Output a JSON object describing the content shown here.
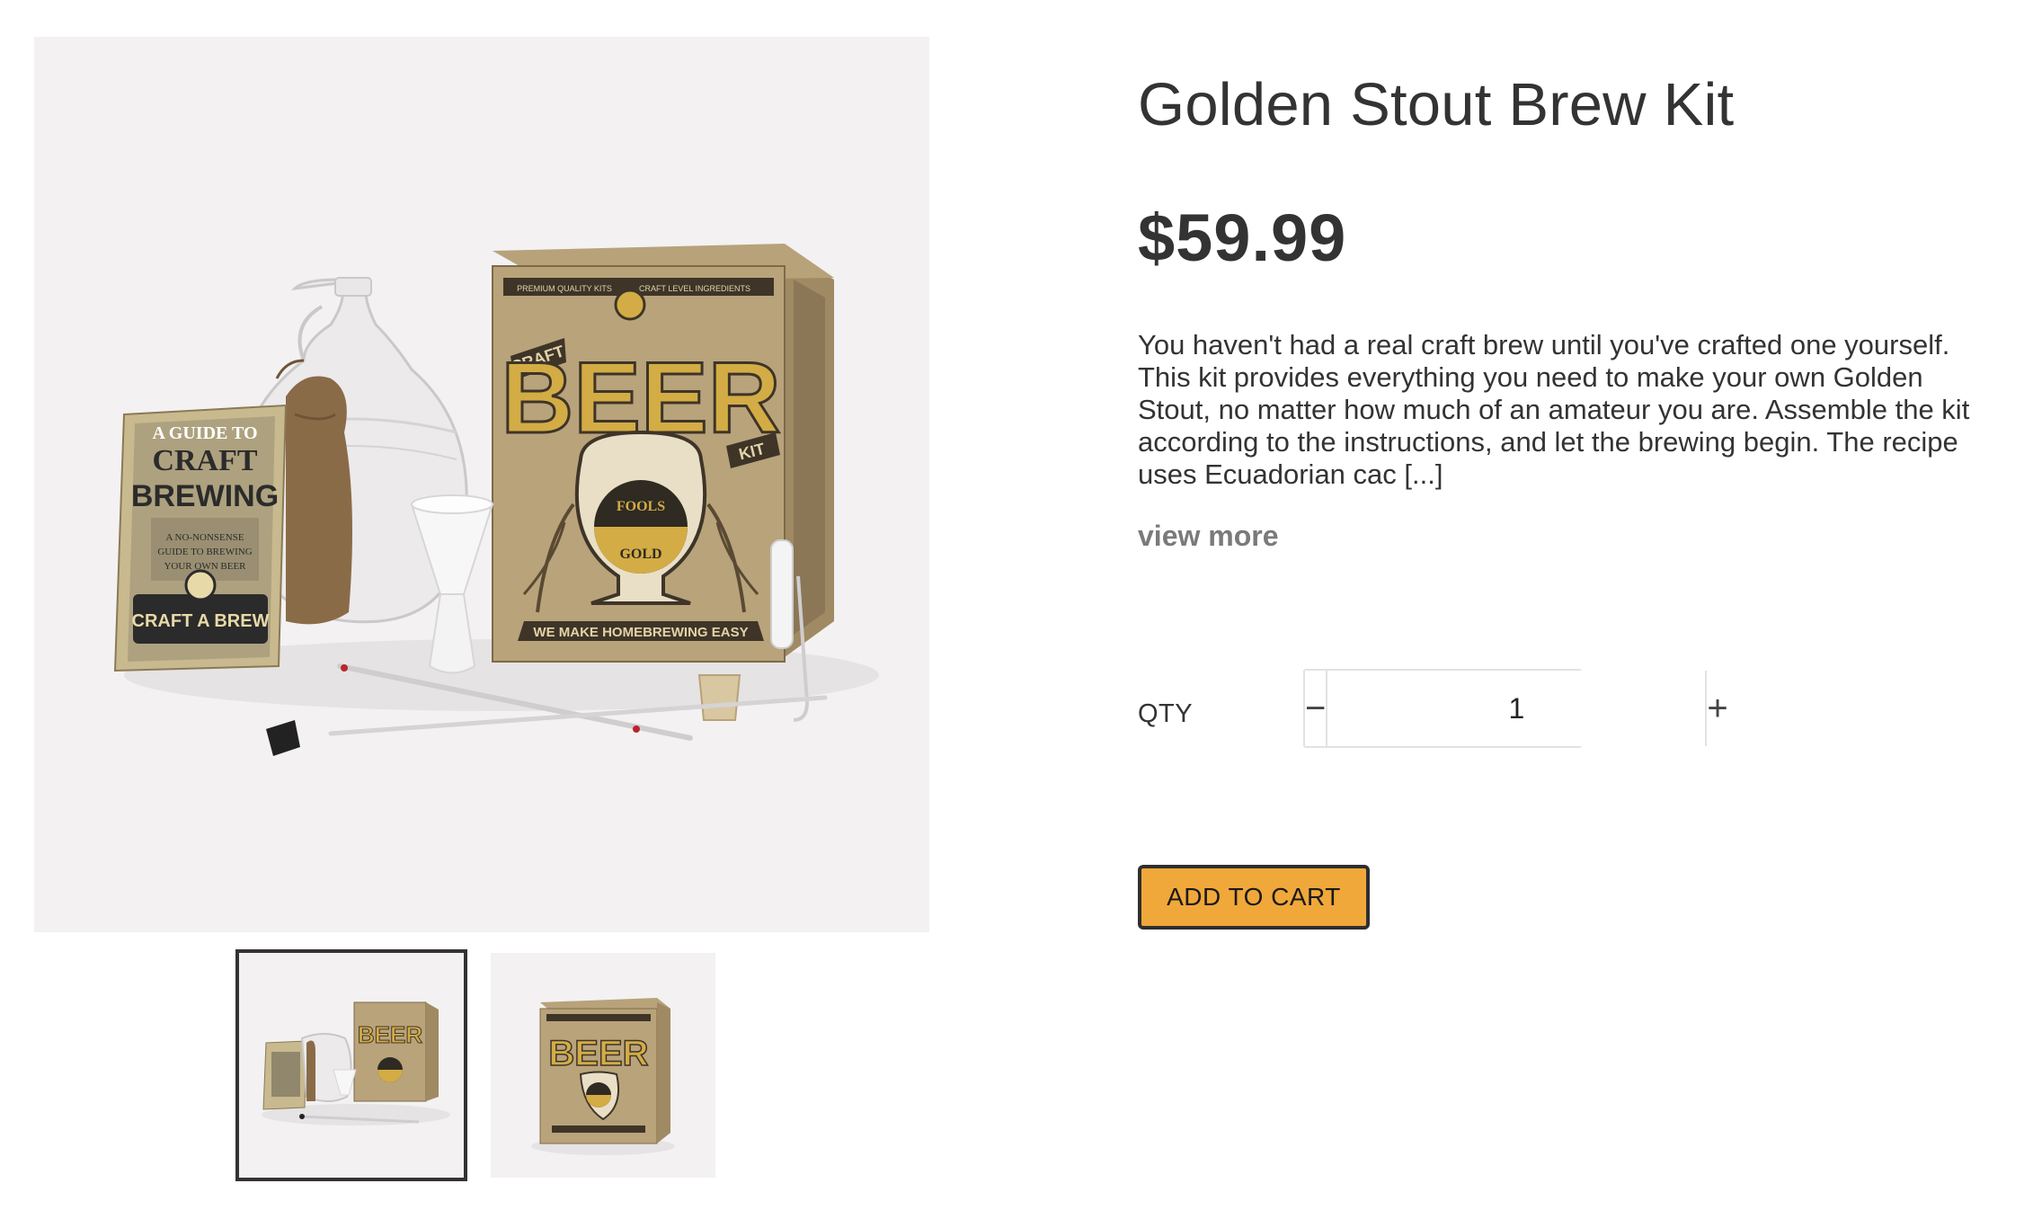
{
  "product": {
    "title": "Golden Stout Brew Kit",
    "price": "$59.99",
    "description": "You haven't had a real craft brew until you've crafted one yourself. This kit provides everything you need to make your own Golden Stout, no matter how much of an amateur you are. Assemble the kit according to the instructions, and let the brewing begin. The recipe uses Ecuadorian cac [...]",
    "view_more": "view more"
  },
  "gallery": {
    "main_image": "craft-beer-kit-photo",
    "thumbnails": [
      {
        "image": "kit-contents-photo",
        "active": true
      },
      {
        "image": "kit-box-photo",
        "active": false
      }
    ]
  },
  "quantity": {
    "label": "QTY",
    "minus": "−",
    "value": "1",
    "plus": "+"
  },
  "cart": {
    "add_label": "ADD TO CART",
    "button_color": "#f0a83a"
  },
  "product_art": {
    "box_brand_top": "CRAFT",
    "box_brand_main": "BEER",
    "box_brand_side": "KIT",
    "box_badge_top": "FOOLS",
    "box_badge_bottom": "GOLD",
    "box_banner": "WE MAKE HOMEBREWING EASY",
    "box_header_left": "PREMIUM QUALITY KITS",
    "box_header_right": "CRAFT LEVEL INGREDIENTS",
    "guide_line1": "A GUIDE TO",
    "guide_line2": "CRAFT",
    "guide_line3": "BREWING",
    "guide_sub": "A NO-NONSENSE GUIDE TO BREWING YOUR OWN BEER",
    "guide_logo": "CRAFT A BREW"
  }
}
